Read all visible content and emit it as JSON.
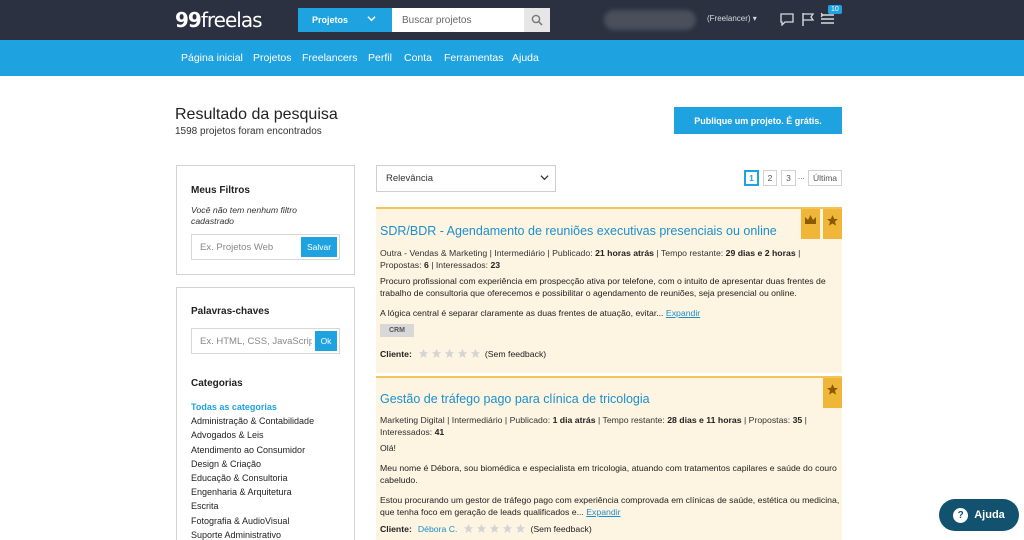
{
  "topbar": {
    "logo_main": "99",
    "logo_rest": "freelas",
    "search_type": "Projetos",
    "search_placeholder": "Buscar projetos",
    "user_role": "(Freelancer) ▾",
    "notifications_count": "10"
  },
  "nav": [
    "Página inicial",
    "Projetos",
    "Freelancers",
    "Perfil",
    "Conta",
    "Ferramentas",
    "Ajuda"
  ],
  "header": {
    "title": "Resultado da pesquisa",
    "count": "1598 projetos foram encontrados",
    "publish": "Publique um projeto. É grátis."
  },
  "filters": {
    "title": "Meus Filtros",
    "empty_text": "Você não tem nenhum filtro cadastrado",
    "placeholder": "Ex. Projetos Web",
    "save": "Salvar"
  },
  "keywords": {
    "title": "Palavras-chaves",
    "placeholder": "Ex. HTML, CSS, JavaScript",
    "ok": "Ok"
  },
  "categories": {
    "title": "Categorias",
    "items": [
      "Todas as categorias",
      "Administração & Contabilidade",
      "Advogados & Leis",
      "Atendimento ao Consumidor",
      "Design & Criação",
      "Educação & Consultoria",
      "Engenharia & Arquitetura",
      "Escrita",
      "Fotografia & AudioVisual",
      "Suporte Administrativo"
    ]
  },
  "sort": {
    "selected": "Relevância"
  },
  "pagination": {
    "pages": [
      "1",
      "2",
      "3"
    ],
    "dots": "...",
    "last": "Última"
  },
  "projects": [
    {
      "title": "SDR/BDR - Agendamento de reuniões executivas presenciais ou online",
      "category": "Outra - Vendas & Marketing | Intermediário | Publicado: ",
      "published": "21 horas atrás",
      "remaining_label": " | Tempo restante: ",
      "remaining": "29 dias e 2 horas",
      "proposals_label": " | Propostas: ",
      "proposals": "6",
      "interested_label": " | Interessados: ",
      "interested": "23",
      "paragraphs": [
        "Procuro profissional com experiência em prospecção ativa por telefone, com o intuito de apresentar duas frentes de trabalho de consultoria que oferecemos e possibilitar o agendamento de reuniões, seja presencial ou online.",
        "A lógica central é separar claramente as duas frentes de atuação, evitar..."
      ],
      "expand": "Expandir",
      "tag": "CRM",
      "client_label": "Cliente:",
      "client_name": "",
      "rating": 0,
      "feedback": "(Sem feedback)"
    },
    {
      "title": "Gestão de tráfego pago para clínica de tricologia",
      "category": "Marketing Digital | Intermediário | Publicado: ",
      "published": "1 dia atrás",
      "remaining_label": " | Tempo restante: ",
      "remaining": "28 dias e 11 horas",
      "proposals_label": " | Propostas: ",
      "proposals": "35",
      "interested_label": " | Interessados: ",
      "interested": "41",
      "paragraphs": [
        "Olá!",
        "Meu nome é Débora, sou biomédica e especialista em tricologia, atuando com tratamentos capilares e saúde do couro cabeludo.",
        "Estou procurando um gestor de tráfego pago com experiência comprovada em clínicas de saúde, estética ou medicina, que tenha foco em geração de leads qualificados e..."
      ],
      "expand": "Expandir",
      "client_label": "Cliente:",
      "client_name": "Débora C.",
      "rating": 0,
      "feedback": "(Sem feedback)"
    }
  ],
  "help": {
    "label": "Ajuda"
  },
  "colors": {
    "brand_blue": "#1fa2e0",
    "topbar": "#2b3140",
    "featured_bg": "#fdf4e1",
    "ribbon": "#f0b637"
  }
}
